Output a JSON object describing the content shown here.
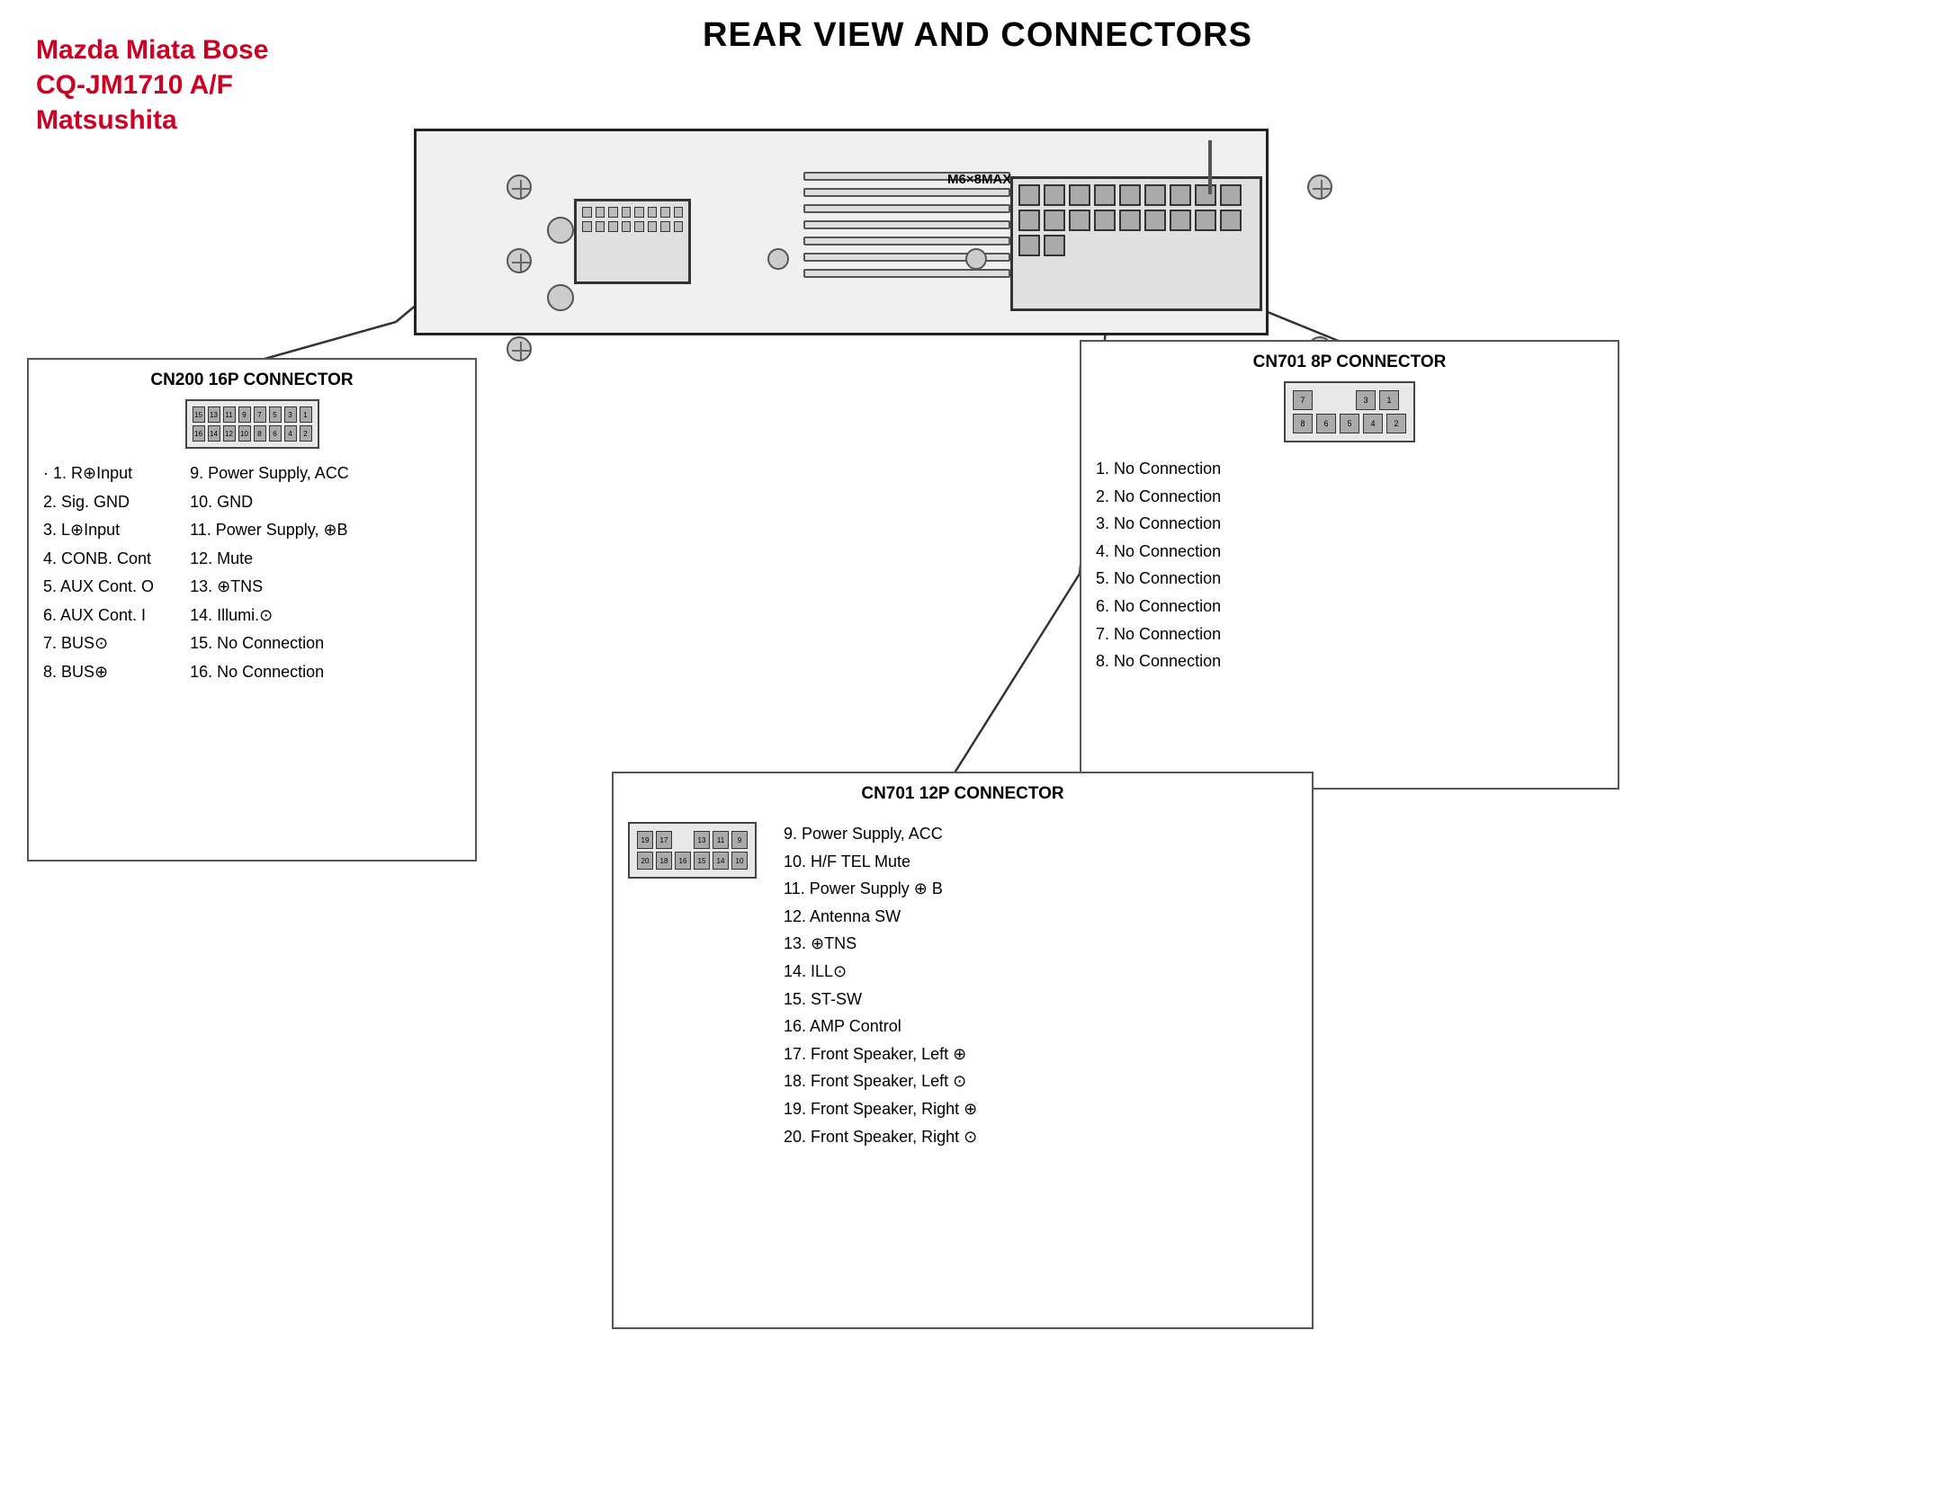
{
  "page": {
    "title": "REAR VIEW AND CONNECTORS",
    "brand": {
      "line1": "Mazda Miata Bose",
      "line2": "CQ-JM1710 A/F",
      "line3": "Matsushita"
    }
  },
  "cn200": {
    "title": "CN200 16P CONNECTOR",
    "pins_left": [
      "1. R⊕Input",
      "2. Sig. GND",
      "3. L⊕Input",
      "4. CONB. Cont",
      "5. AUX Cont. O",
      "6. AUX Cont. I",
      "7. BUS⊙",
      "8. BUS⊕"
    ],
    "pins_right": [
      "9. Power Supply, ACC",
      "10. GND",
      "11. Power Supply, ⊕B",
      "12. Mute",
      "13. ⊕TNS",
      "14. Illumi.⊙",
      "15. No Connection",
      "16. No Connection"
    ]
  },
  "cn701_8p": {
    "title": "CN701 8P CONNECTOR",
    "pins": [
      "1. No Connection",
      "2. No Connection",
      "3. No Connection",
      "4. No Connection",
      "5. No Connection",
      "6. No Connection",
      "7. No Connection",
      "8. No Connection"
    ]
  },
  "cn701_12p": {
    "title": "CN701 12P CONNECTOR",
    "pins": [
      "9. Power Supply, ACC",
      "10. H/F TEL Mute",
      "11. Power Supply ⊕ B",
      "12. Antenna SW",
      "13. ⊕TNS",
      "14. ILL⊙",
      "15. ST-SW",
      "16. AMP Control",
      "17. Front Speaker, Left ⊕",
      "18. Front Speaker, Left ⊙",
      "19. Front Speaker, Right ⊕",
      "20. Front Speaker, Right ⊙"
    ]
  },
  "no_connection_label": "No Connection"
}
